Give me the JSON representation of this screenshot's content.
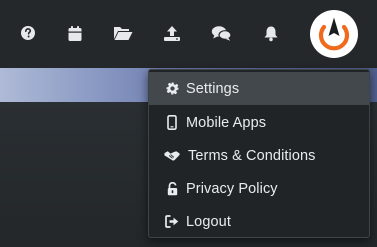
{
  "header": {
    "icons": [
      "help-circle-icon",
      "calendar-icon",
      "folder-open-icon",
      "upload-icon",
      "chat-bubbles-icon",
      "bell-icon"
    ],
    "avatar_icon": "brand-logo-icon",
    "accent": "#f06a1e"
  },
  "menu": {
    "items": [
      {
        "label": "Settings",
        "icon": "gear-icon",
        "active": true
      },
      {
        "label": "Mobile Apps",
        "icon": "mobile-phone-icon",
        "active": false
      },
      {
        "label": "Terms & Conditions",
        "icon": "handshake-icon",
        "active": false
      },
      {
        "label": "Privacy Policy",
        "icon": "unlock-icon",
        "active": false
      },
      {
        "label": "Logout",
        "icon": "sign-out-icon",
        "active": false
      }
    ]
  }
}
